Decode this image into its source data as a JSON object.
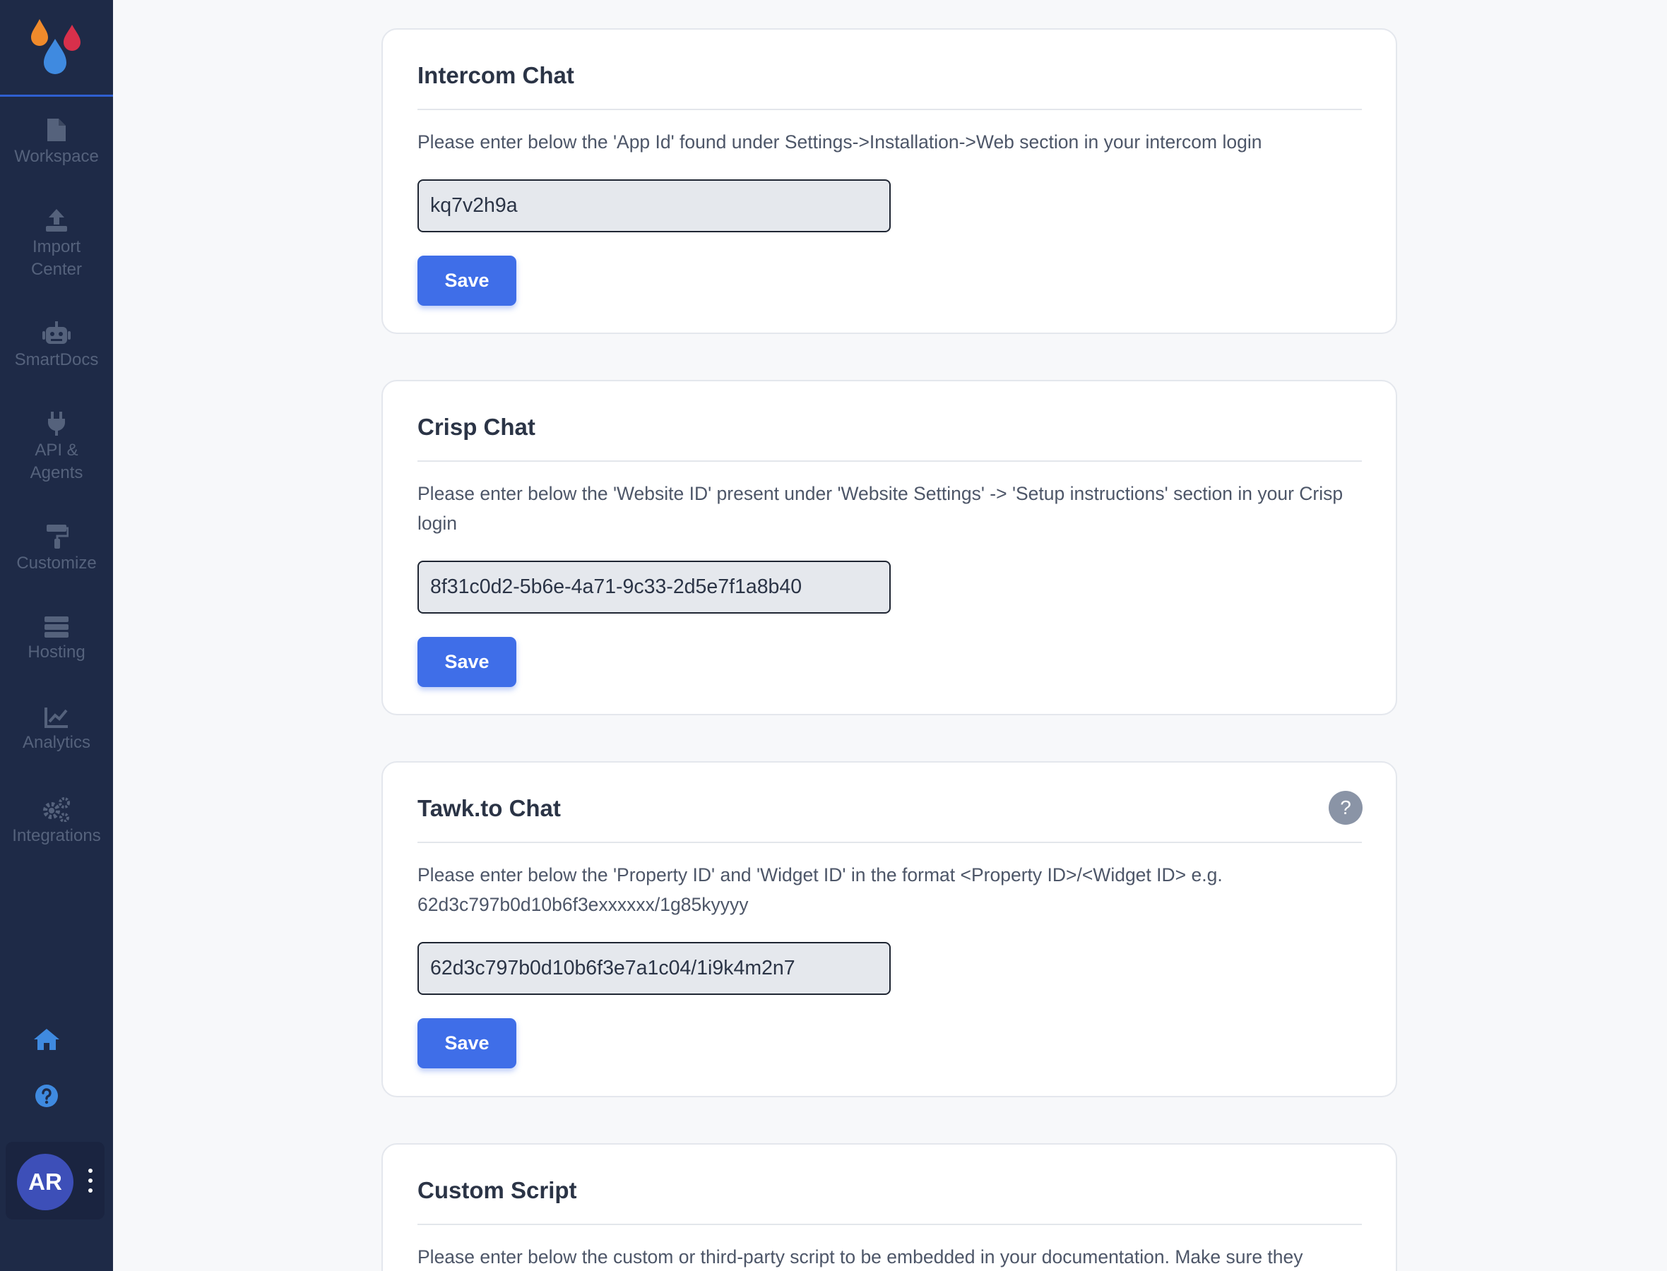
{
  "sidebar": {
    "items": [
      {
        "label": "Workspace",
        "icon": "file-icon"
      },
      {
        "label": "Import Center",
        "icon": "upload-icon"
      },
      {
        "label": "SmartDocs",
        "icon": "robot-icon"
      },
      {
        "label": "API & Agents",
        "icon": "plug-icon"
      },
      {
        "label": "Customize",
        "icon": "paint-roller-icon"
      },
      {
        "label": "Hosting",
        "icon": "server-icon"
      },
      {
        "label": "Analytics",
        "icon": "chart-line-icon"
      },
      {
        "label": "Integrations",
        "icon": "gears-icon"
      }
    ],
    "avatar_initials": "AR",
    "colors": {
      "background": "#1e2a47",
      "item_text": "#55627c",
      "accent": "#3f8ae0"
    }
  },
  "cards": [
    {
      "title": "Intercom Chat",
      "description": "Please enter below the 'App Id' found under Settings->Installation->Web section in your intercom login",
      "input_value": "kq7v2h9a",
      "save_label": "Save"
    },
    {
      "title": "Crisp Chat",
      "description": "Please enter below the 'Website ID' present under 'Website Settings' -> 'Setup instructions' section in your Crisp login",
      "input_value": "8f31c0d2-5b6e-4a71-9c33-2d5e7f1a8b40",
      "save_label": "Save"
    },
    {
      "title": "Tawk.to Chat",
      "description": "Please enter below the 'Property ID' and 'Widget ID' in the format <Property ID>/<Widget ID> e.g. 62d3c797b0d10b6f3exxxxxx/1g85kyyyy",
      "input_value": "62d3c797b0d10b6f3e7a1c04/1i9k4m2n7",
      "save_label": "Save",
      "help_label": "?"
    },
    {
      "title": "Custom Script",
      "description": "Please enter below the custom or third-party script to be embedded in your documentation. Make sure they"
    }
  ],
  "theme": {
    "button": "#3f6ee8",
    "input_bg": "#e5e8ed",
    "card_border": "#e4e7ed",
    "page_bg": "#f7f8fa"
  }
}
